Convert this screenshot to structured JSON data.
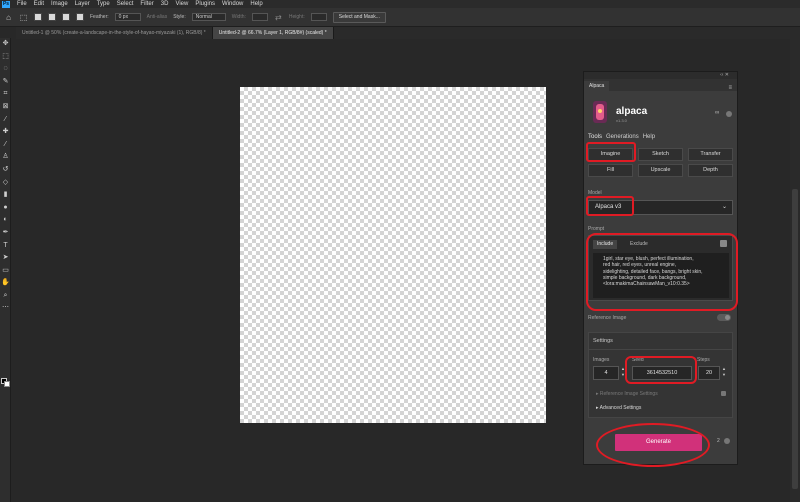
{
  "menu": {
    "app_icon": "Ps",
    "items": [
      "File",
      "Edit",
      "Image",
      "Layer",
      "Type",
      "Select",
      "Filter",
      "3D",
      "View",
      "Plugins",
      "Window",
      "Help"
    ]
  },
  "options": {
    "feather_label": "Feather:",
    "feather_value": "0 px",
    "antialias_label": "Anti-alias",
    "style_label": "Style:",
    "style_value": "Normal",
    "width_label": "Width:",
    "height_label": "Height:",
    "select_mask_button": "Select and Mask..."
  },
  "tabs": [
    {
      "label": "Untitled-1 @ 50% (create-a-landscape-in-the-style-of-hayao-miyazaki (1), RGB/8) *"
    },
    {
      "label": "Untitled-2 @ 66.7% (Layer 1, RGB/8#) (scaled) *"
    }
  ],
  "panel": {
    "tab_label": "Alpaca",
    "top_arrows": "‹‹ ✕",
    "menu_icon": "≡",
    "brand": "alpaca",
    "version": "v1.3.0",
    "credits_symbol": "∞",
    "sections": [
      "Tools",
      "Generations",
      "Help"
    ],
    "tools": [
      "Imagine",
      "Sketch",
      "Transfer",
      "Fill",
      "Upscale",
      "Depth"
    ],
    "model_label": "Model",
    "model_value": "Alpaca v3",
    "prompt_label": "Prompt",
    "include_tab": "Include",
    "exclude_tab": "Exclude",
    "prompt_text": "1girl, star eye, blush, perfect illumination,\nred hair, red eyes, unreal engine,\nsidelighting, detailed face, bangs, bright skin,\nsimple background, dark background,\n<lora:makimaChainsawMan_v10:0.35>",
    "reference_image_label": "Reference Image",
    "settings_title": "Settings",
    "images_label": "Images",
    "images_value": "4",
    "seed_label": "Seed",
    "seed_value": "3614532510",
    "steps_label": "Steps",
    "steps_value": "20",
    "reference_settings_label": "Reference Image Settings",
    "advanced_settings_label": "Advanced Settings",
    "generate_label": "Generate",
    "generate_count": "2"
  },
  "colors": {
    "accent": "#d1317a",
    "annotation": "#e01b24",
    "photoshop_blue": "#31a8ff"
  }
}
